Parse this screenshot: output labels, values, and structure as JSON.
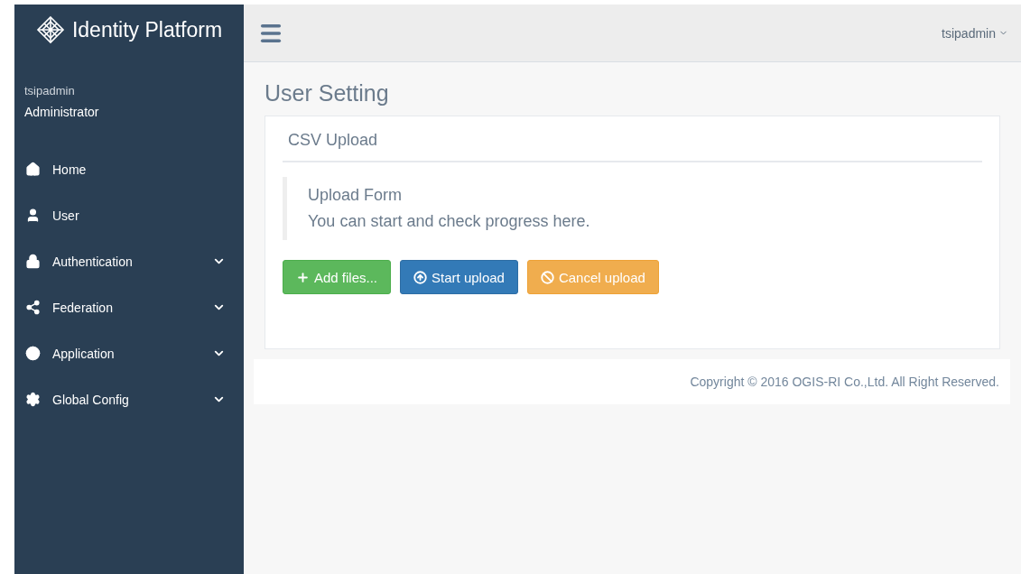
{
  "sidebar": {
    "brand": "Identity Platform",
    "user": {
      "name": "tsipadmin",
      "role": "Administrator"
    },
    "items": [
      {
        "label": "Home"
      },
      {
        "label": "User"
      },
      {
        "label": "Authentication",
        "expanded": false
      },
      {
        "label": "Federation",
        "expanded": false
      },
      {
        "label": "Application",
        "expanded": false
      },
      {
        "label": "Global Config",
        "expanded": false
      }
    ]
  },
  "header": {
    "user_menu": "tsipadmin"
  },
  "page": {
    "title": "User Setting",
    "panel": {
      "title": "CSV Upload",
      "note": {
        "title": "Upload Form",
        "text": "You can start and check progress here."
      },
      "buttons": [
        {
          "label": "Add files...",
          "kind": "success"
        },
        {
          "label": "Start upload",
          "kind": "primary"
        },
        {
          "label": "Cancel upload",
          "kind": "warning"
        }
      ]
    }
  },
  "footer": "Copyright © 2016 OGIS-RI Co.,Ltd. All Right Reserved."
}
